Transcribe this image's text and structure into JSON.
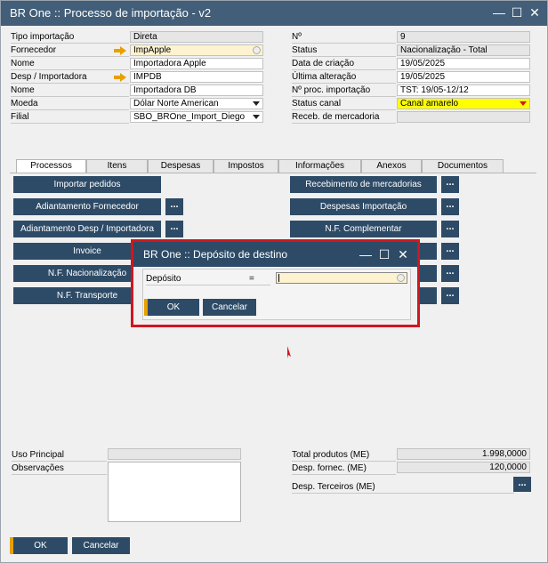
{
  "window": {
    "title": "BR One :: Processo de importação - v2",
    "min_icon": "minimize-icon",
    "max_icon": "maximize-icon",
    "close_icon": "close-icon"
  },
  "header_left": {
    "tipo_label": "Tipo importação",
    "tipo_value": "Direta",
    "fornecedor_label": "Fornecedor",
    "fornecedor_value": "ImpApple",
    "nome1_label": "Nome",
    "nome1_value": "Importadora Apple",
    "desp_label": "Desp / Importadora",
    "desp_value": "IMPDB",
    "nome2_label": "Nome",
    "nome2_value": "Importadora DB",
    "moeda_label": "Moeda",
    "moeda_value": "Dólar Norte American",
    "filial_label": "Filial",
    "filial_value": "SBO_BROne_Import_Diego"
  },
  "header_right": {
    "num_label": "Nº",
    "num_value": "9",
    "status_label": "Status",
    "status_value": "Nacionalização - Total",
    "criacao_label": "Data de criação",
    "criacao_value": "19/05/2025",
    "alteracao_label": "Última alteração",
    "alteracao_value": "19/05/2025",
    "proc_label": "Nº proc. importação",
    "proc_value": "TST: 19/05-12/12",
    "canal_label": "Status canal",
    "canal_value": "Canal amarelo",
    "receb_label": "Receb. de mercadoria",
    "receb_value": ""
  },
  "tabs": [
    "Processos",
    "Itens",
    "Despesas",
    "Impostos",
    "Informações",
    "Anexos",
    "Documentos"
  ],
  "left_buttons": [
    "Importar pedidos",
    "Adiantamento Fornecedor",
    "Adiantamento Desp / Importadora",
    "Invoice",
    "N.F. Nacionalização",
    "N.F. Transporte"
  ],
  "right_buttons": [
    "Recebimento de mercadorias",
    "Despesas Importação",
    "N.F. Complementar"
  ],
  "dots_label": "...",
  "footer": {
    "uso_label": "Uso Principal",
    "obs_label": "Observações",
    "total_label": "Total produtos (ME)",
    "total_value": "1.998,0000",
    "fornec_label": "Desp. fornec. (ME)",
    "fornec_value": "120,0000",
    "terceiros_label": "Desp. Terceiros (ME)"
  },
  "actions": {
    "ok": "OK",
    "cancel": "Cancelar"
  },
  "modal": {
    "title": "BR One :: Depósito de destino",
    "deposito_label": "Depósito",
    "equals": "=",
    "deposito_value": "",
    "ok": "OK",
    "cancel": "Cancelar"
  },
  "colors": {
    "titlebar": "#425e78",
    "button": "#2d4b67",
    "canal": "#ffff00",
    "highlight": "#d0161e",
    "ok_accent": "#e8a000"
  }
}
